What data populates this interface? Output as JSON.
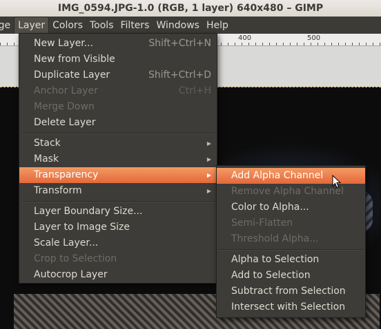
{
  "window": {
    "title": "IMG_0594.JPG-1.0 (RGB, 1 layer) 640x480 – GIMP"
  },
  "menubar": {
    "items": [
      "age",
      "Layer",
      "Colors",
      "Tools",
      "Filters",
      "Windows",
      "Help"
    ],
    "active": "Layer"
  },
  "ruler": {
    "labels": [
      "400",
      "500"
    ]
  },
  "layer_menu": {
    "items": [
      {
        "label": "New Layer...",
        "accel": "Shift+Ctrl+N",
        "enabled": true
      },
      {
        "label": "New from Visible",
        "accel": "",
        "enabled": true
      },
      {
        "label": "Duplicate Layer",
        "accel": "Shift+Ctrl+D",
        "enabled": true
      },
      {
        "label": "Anchor Layer",
        "accel": "Ctrl+H",
        "enabled": false
      },
      {
        "label": "Merge Down",
        "accel": "",
        "enabled": false
      },
      {
        "label": "Delete Layer",
        "accel": "",
        "enabled": true
      },
      {
        "label": "Stack",
        "submenu": true,
        "enabled": true
      },
      {
        "label": "Mask",
        "submenu": true,
        "enabled": true
      },
      {
        "label": "Transparency",
        "submenu": true,
        "enabled": true,
        "highlighted": true
      },
      {
        "label": "Transform",
        "submenu": true,
        "enabled": true
      },
      {
        "label": "Layer Boundary Size...",
        "enabled": true
      },
      {
        "label": "Layer to Image Size",
        "enabled": true
      },
      {
        "label": "Scale Layer...",
        "enabled": true
      },
      {
        "label": "Crop to Selection",
        "enabled": false
      },
      {
        "label": "Autocrop Layer",
        "enabled": true
      }
    ]
  },
  "transparency_menu": {
    "items": [
      {
        "label": "Add Alpha Channel",
        "enabled": true,
        "highlighted": true
      },
      {
        "label": "Remove Alpha Channel",
        "enabled": false
      },
      {
        "label": "Color to Alpha...",
        "enabled": true
      },
      {
        "label": "Semi-Flatten",
        "enabled": false
      },
      {
        "label": "Threshold Alpha...",
        "enabled": false
      },
      {
        "label": "Alpha to Selection",
        "enabled": true
      },
      {
        "label": "Add to Selection",
        "enabled": true
      },
      {
        "label": "Subtract from Selection",
        "enabled": true
      },
      {
        "label": "Intersect with Selection",
        "enabled": true
      }
    ]
  },
  "colors": {
    "highlight": "#ee7b47",
    "menu_bg": "#3d3c38",
    "disabled_text": "#6e6c66"
  },
  "icons": [
    "submenu-arrow-icon",
    "mouse-pointer-icon"
  ]
}
